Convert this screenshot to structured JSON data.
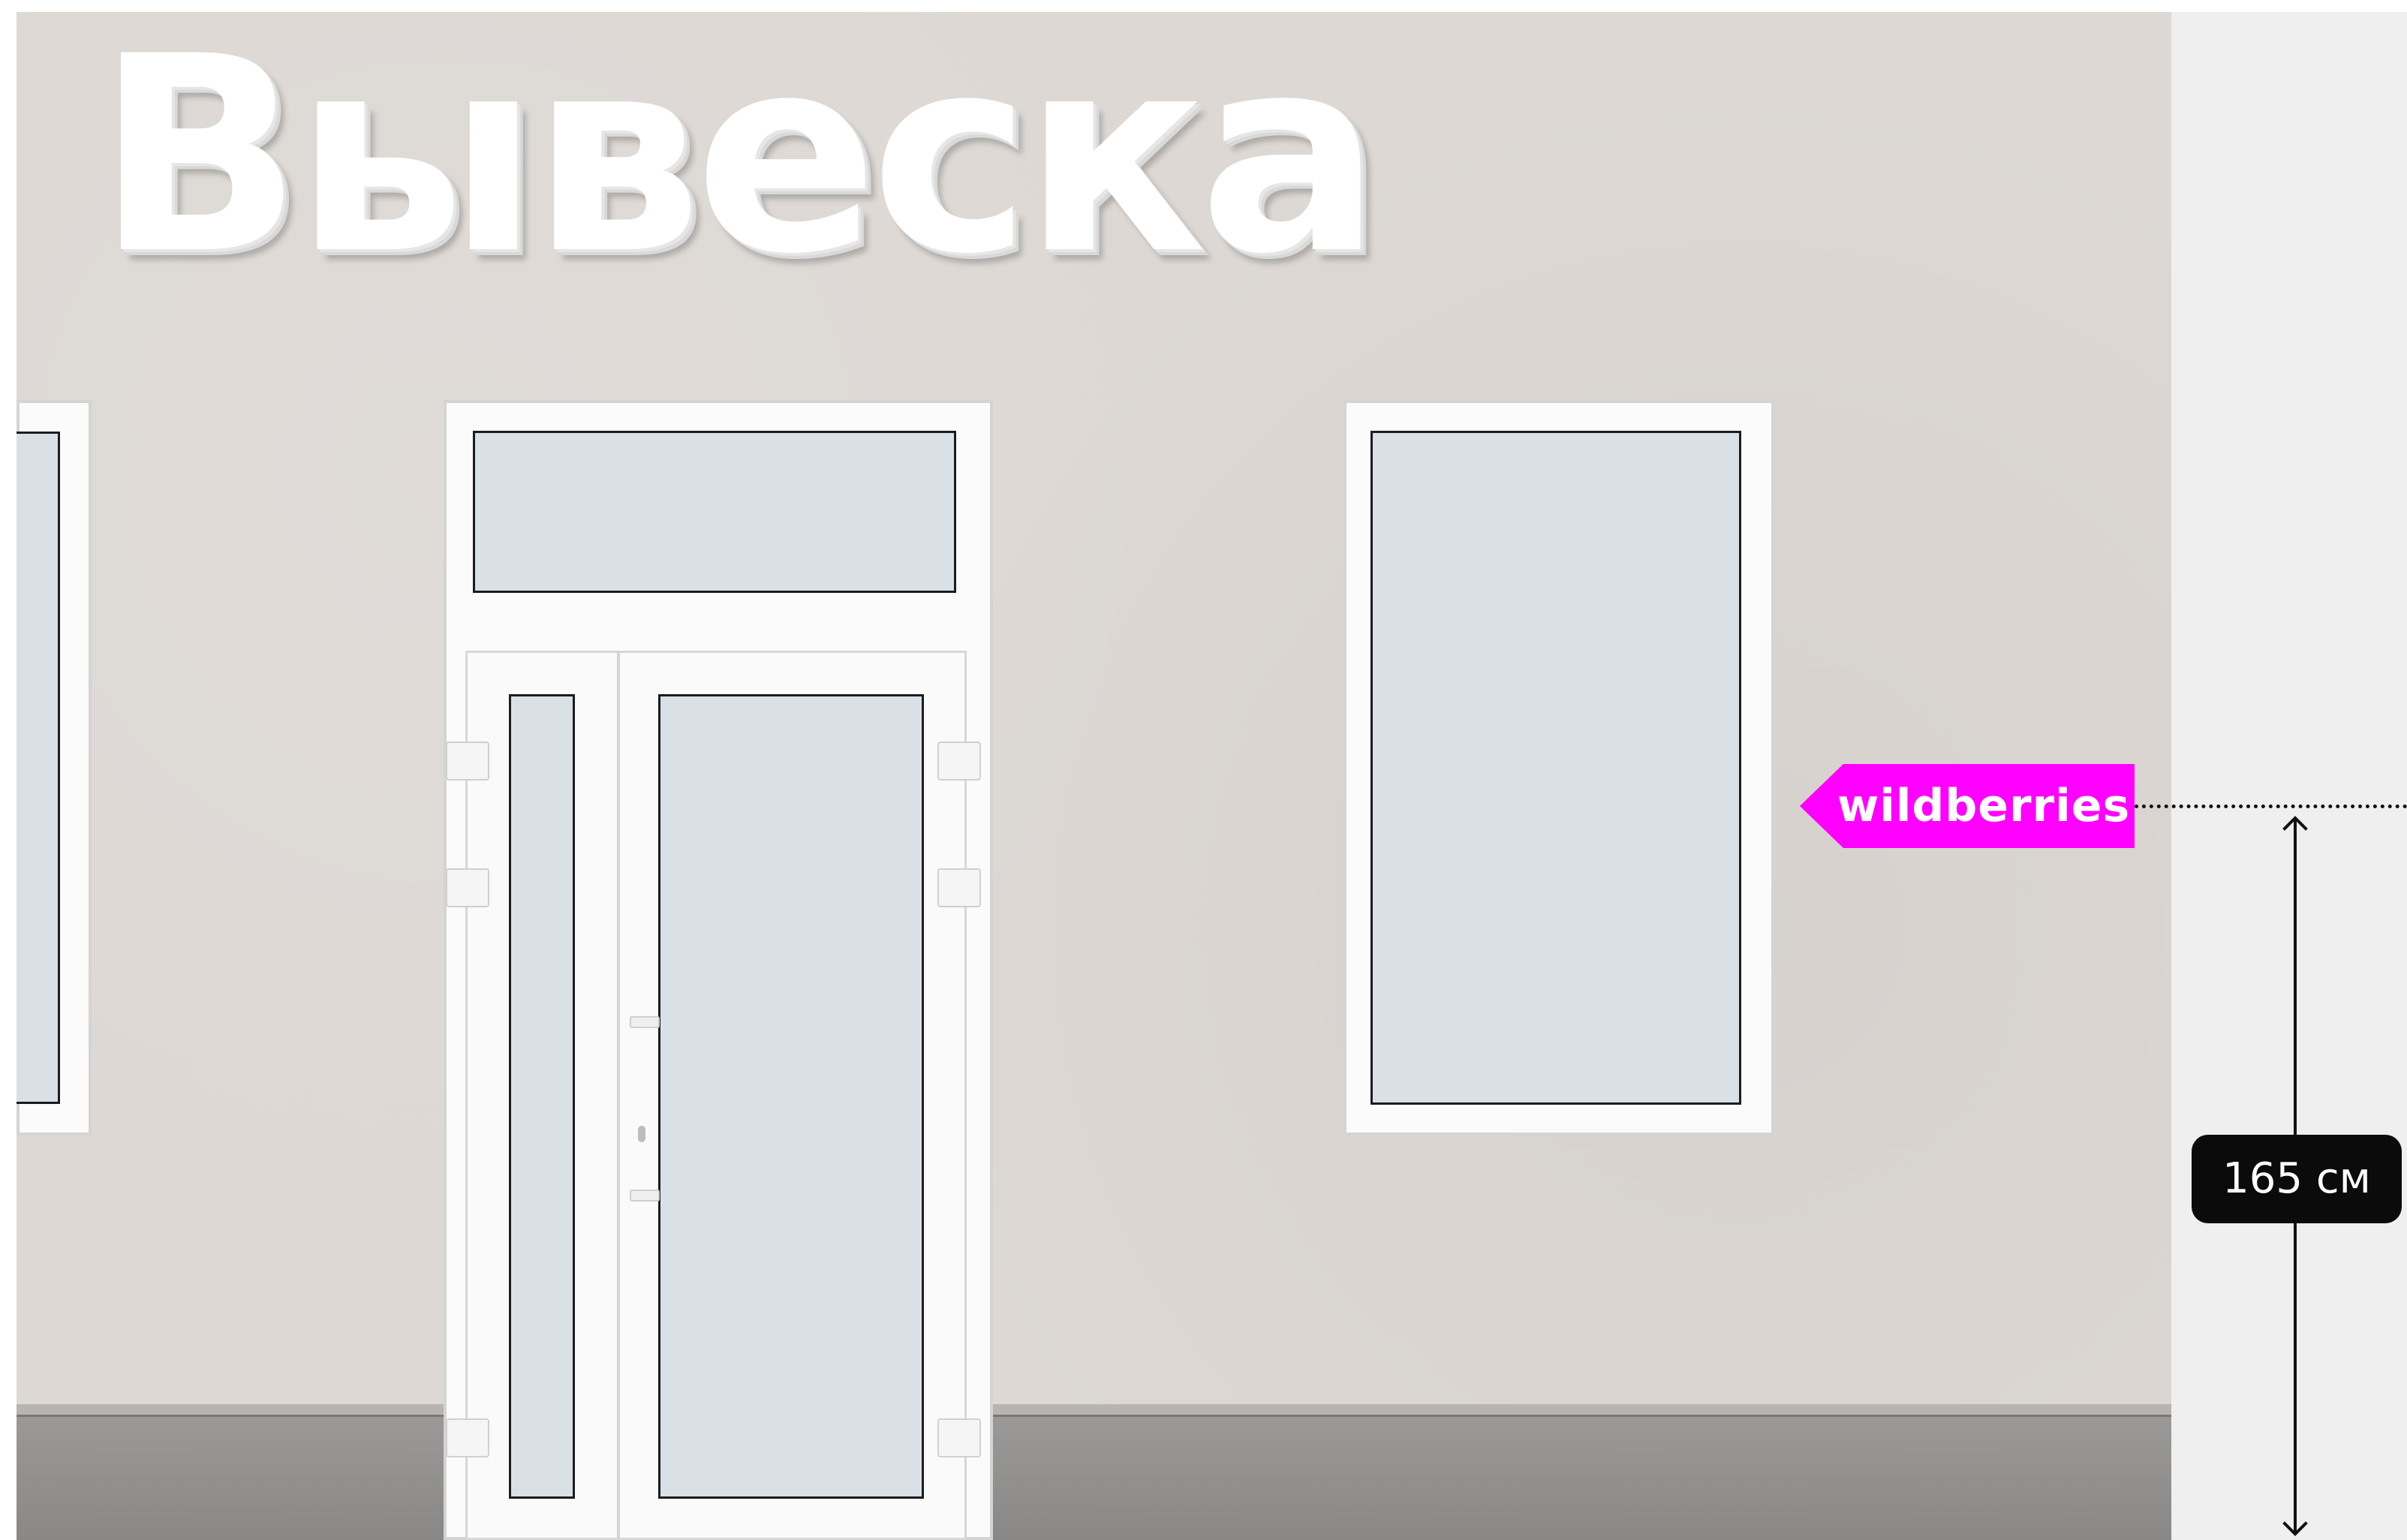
{
  "sign": {
    "title": "Вывеска"
  },
  "wb_sign": {
    "text": "wildberries",
    "color": "#ff00ff"
  },
  "measurement": {
    "label": "165 см"
  },
  "colors": {
    "wall": "#ddd8d4",
    "side_panel": "#efefef",
    "glass": "#d9e1e7",
    "frame": "#fbfbfb",
    "plinth": "#9d9b99",
    "dark_label": "#0b0b0b"
  }
}
